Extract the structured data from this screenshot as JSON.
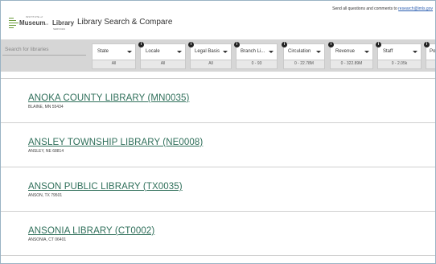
{
  "header": {
    "logo": {
      "small_top": "INSTITUTE of",
      "word1": "Museum",
      "small_mid": "and",
      "word2": "Library",
      "small_bot": "SERVICES"
    },
    "app_title": "Library Search & Compare",
    "contact_text": "Send all questions and comments to ",
    "contact_email": "research@imls.gov"
  },
  "search": {
    "placeholder": "Search for libraries"
  },
  "filters": [
    {
      "label": "State",
      "value": "All",
      "info": false
    },
    {
      "label": "Locale",
      "value": "All",
      "info": true
    },
    {
      "label": "Legal Basis",
      "value": "All",
      "info": true
    },
    {
      "label": "Branch Li...",
      "value": "0 - 93",
      "info": true
    },
    {
      "label": "Circulation",
      "value": "0 - 22.78M",
      "info": true
    },
    {
      "label": "Revenue",
      "value": "0 - 322.89M",
      "info": true
    },
    {
      "label": "Staff",
      "value": "0 - 2.05k",
      "info": true
    },
    {
      "label": "Po",
      "value": "",
      "info": true
    }
  ],
  "libraries": [
    {
      "name": "ANOKA COUNTY LIBRARY (MN0035)",
      "address": "BLAINE, MN 55434"
    },
    {
      "name": "ANSLEY TOWNSHIP LIBRARY (NE0008)",
      "address": "ANSLEY, NE 68814"
    },
    {
      "name": "ANSON PUBLIC LIBRARY (TX0035)",
      "address": "ANSON, TX 79501"
    },
    {
      "name": "ANSONIA LIBRARY (CT0002)",
      "address": "ANSONIA, CT 06401"
    }
  ],
  "colors": {
    "link": "#2f6f5a",
    "bar": "#d6d6d6",
    "accent_logo": "#6a9b3a"
  }
}
